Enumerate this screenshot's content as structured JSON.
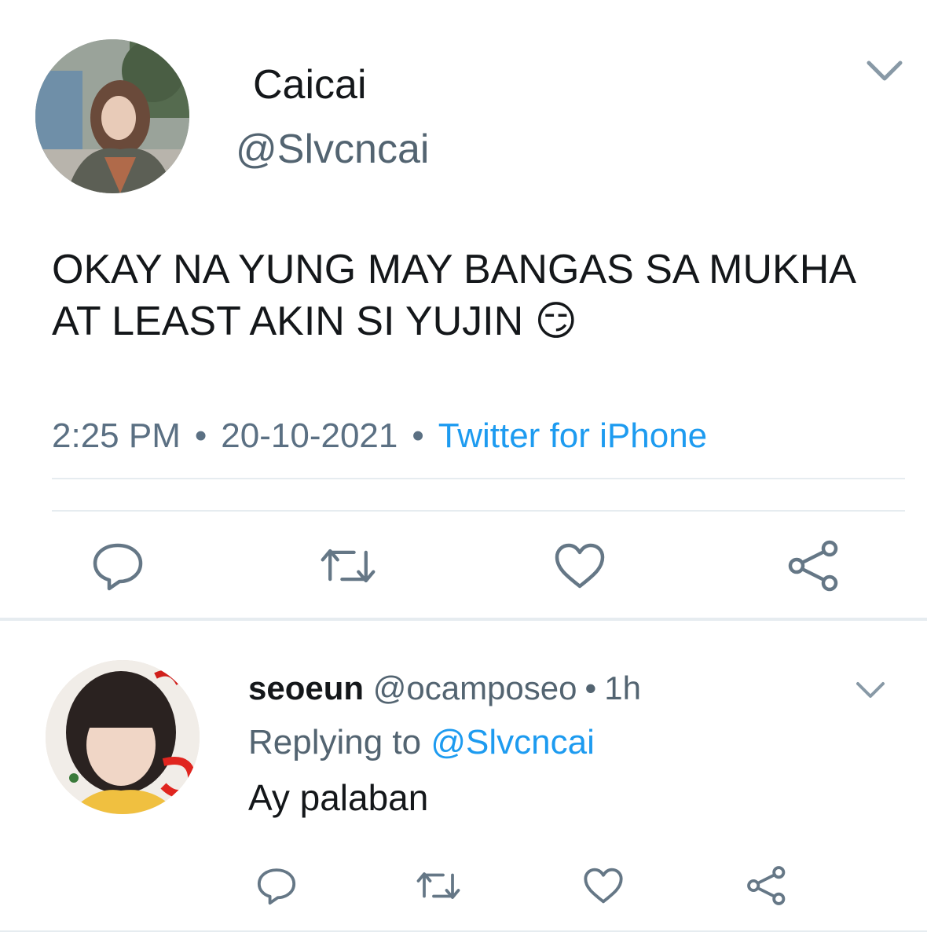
{
  "tweet": {
    "display_name": "Caicai",
    "handle": "@Slvcncai",
    "text": "OKAY NA YUNG MAY BANGAS SA MUKHA AT LEAST AKIN SI YUJIN 😏",
    "time": "2:25 PM",
    "date": "20-10-2021",
    "separator": "•",
    "source": "Twitter for iPhone",
    "actions": [
      "reply-icon",
      "retweet-icon",
      "like-icon",
      "share-icon"
    ]
  },
  "reply": {
    "display_name": "seoeun",
    "handle": "@ocamposeo",
    "separator": "•",
    "time": "1h",
    "replying_prefix": "Replying to",
    "replying_to": "@Slvcncai",
    "text": "Ay palaban",
    "actions": [
      "reply-icon",
      "retweet-icon",
      "like-icon",
      "share-icon"
    ]
  },
  "colors": {
    "text": "#14171a",
    "secondary": "#536471",
    "link": "#1d9bf0",
    "divider": "#e6ecf0",
    "icon": "#657786"
  }
}
